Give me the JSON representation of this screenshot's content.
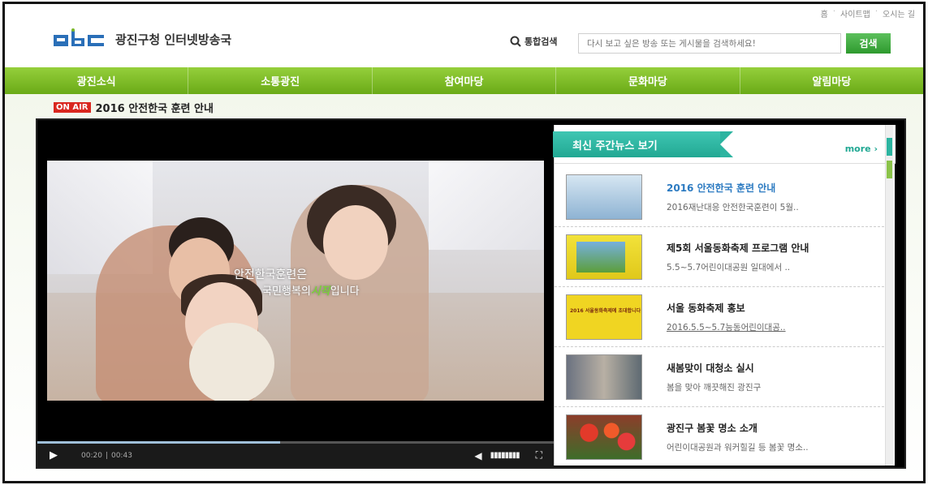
{
  "util_links": [
    "홈",
    "사이트맵",
    "오시는 길"
  ],
  "logo": {
    "mark": "gbc",
    "text": "광진구청 인터넷방송국"
  },
  "search": {
    "label": "통합검색",
    "placeholder": "다시 보고 싶은 방송 또는 게시물을 검색하세요!",
    "button": "검색"
  },
  "nav": [
    "광진소식",
    "소통광진",
    "참여마당",
    "문화마당",
    "알림마당"
  ],
  "onair": {
    "badge": "ON AIR",
    "title": "2016 안전한국 훈련 안내"
  },
  "video": {
    "caption1": "안전한국훈련은",
    "caption2_pre": "국민행복의",
    "caption2_highlight": "시작",
    "caption2_post": "입니다",
    "current_time": "00:20",
    "duration": "00:43",
    "progress": 0.47
  },
  "news": {
    "heading": "최신 주간뉴스 보기",
    "more": "more ›",
    "items": [
      {
        "title": "2016 안전한국 훈련 안내",
        "sub": "2016재난대응 안전한국훈련이 5월..",
        "active": true
      },
      {
        "title": "제5회 서울동화축제 프로그램 안내",
        "sub": "5.5~5.7어린이대공원 일대에서 ..",
        "active": false
      },
      {
        "title": "서울 동화축제 홍보",
        "sub": "2016.5.5~5.7능동어린이대공..",
        "active": false,
        "thumb_text": "2016 서울동화축제에 초대합니다"
      },
      {
        "title": "새봄맞이 대청소 실시",
        "sub": "봄을 맞아 깨끗해진 광진구",
        "active": false
      },
      {
        "title": "광진구 봄꽃 명소 소개",
        "sub": "어린이대공원과 워커힐길 등 봄꽃 명소..",
        "active": false
      }
    ]
  },
  "colors": {
    "nav": "#7cb829",
    "accent": "#21a893",
    "onair": "#d9271f",
    "link": "#2b7ac1"
  }
}
